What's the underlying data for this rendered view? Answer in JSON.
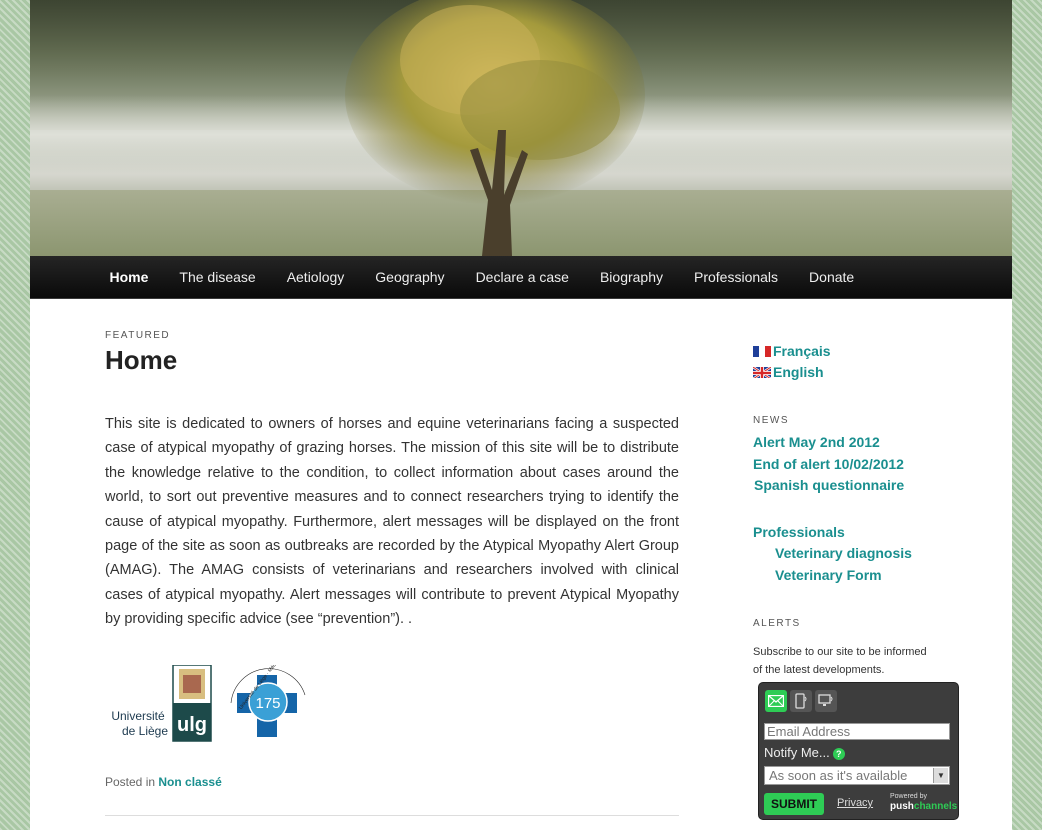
{
  "nav": {
    "items": [
      {
        "label": "Home",
        "active": true
      },
      {
        "label": "The disease"
      },
      {
        "label": "Aetiology"
      },
      {
        "label": "Geography"
      },
      {
        "label": "Declare a case"
      },
      {
        "label": "Biography"
      },
      {
        "label": "Professionals"
      },
      {
        "label": "Donate"
      }
    ]
  },
  "post": {
    "featured_label": "FEATURED",
    "title": "Home",
    "body": "This site is dedicated to owners of horses and equine veterinarians facing a suspected case of atypical myopathy of grazing horses. The mission of this site will be to distribute the knowledge relative to the condition, to collect information about cases around the world, to sort out preventive measures and to connect researchers trying to identify the cause of atypical myopathy.  Furthermore, alert messages will be displayed on the front page of the site as soon as outbreaks are recorded by the Atypical Myopathy Alert Group (AMAG).  The AMAG consists of veterinarians and researchers involved with clinical cases of atypical myopathy.  Alert messages will contribute to prevent Atypical Myopathy by providing specific advice (see “prevention”). .",
    "posted_in": "Posted in",
    "category": "Non classé"
  },
  "logos": {
    "ulg_name_line1": "Université",
    "ulg_name_line2": "de Liège",
    "ulg_mark": "ulg",
    "anniversary_number": "175",
    "anniversary_ring_text": "Université de Liège · Médecine vétérinaire"
  },
  "sidebar": {
    "languages": [
      {
        "label": "Français",
        "flag": "fr-flag-icon"
      },
      {
        "label": "English",
        "flag": "uk-flag-icon"
      }
    ],
    "news_title": "NEWS",
    "news": [
      "Alert May 2nd 2012",
      "End of alert 10/02/2012",
      "Spanish questionnaire"
    ],
    "professionals": {
      "label": "Professionals",
      "children": [
        "Veterinary diagnosis",
        "Veterinary Form"
      ]
    },
    "alerts_title": "ALERTS",
    "alerts_text_line1": "Subscribe to our site to be informed",
    "alerts_text_line2": "of the latest developments."
  },
  "subscribe": {
    "email_placeholder": "Email Address",
    "notify_label": "Notify Me...",
    "help": "?",
    "frequency_value": "As soon as it's available",
    "submit_label": "SUBMIT",
    "privacy_label": "Privacy",
    "powered_line1": "Powered by",
    "powered_line2a": "push",
    "powered_line2b": "channels"
  },
  "colors": {
    "link": "#1a8f8f",
    "nav_bg": "#111111",
    "accent_green": "#2ecc55",
    "page_bg": "#a9c7a4"
  }
}
